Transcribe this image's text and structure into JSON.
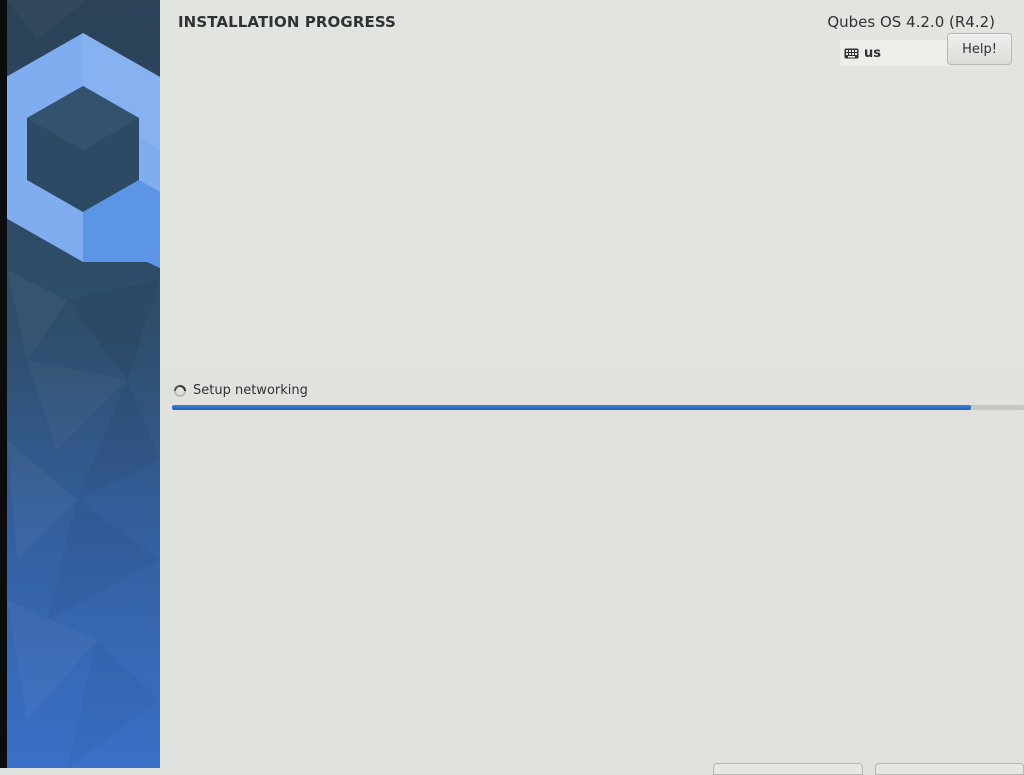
{
  "header": {
    "title": "INSTALLATION PROGRESS",
    "product": "Qubes OS 4.2.0 (R4.2)",
    "keyboard_layout": "us",
    "help_label": "Help!"
  },
  "progress": {
    "status": "Setup networking",
    "fraction": 0.938
  },
  "colors": {
    "accent": "#3874cb",
    "sidebar_top": "#2c4a63",
    "sidebar_bottom": "#3a6fc8",
    "logo": "#80acf0"
  },
  "icons": {
    "keyboard": "keyboard-icon",
    "spinner": "spinner-icon",
    "logo": "qubes-logo"
  }
}
